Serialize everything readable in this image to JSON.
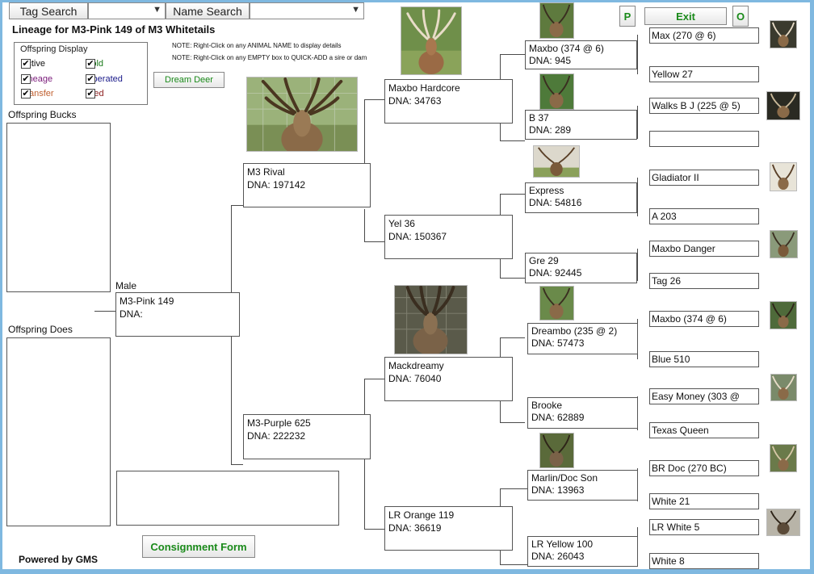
{
  "toolbar": {
    "tag_search_label": "Tag Search",
    "name_search_label": "Name Search",
    "p_label": "P",
    "exit_label": "Exit",
    "o_label": "O"
  },
  "page_title": "Lineage for M3-Pink 149 of M3 Whitetails",
  "notes": [
    "NOTE: Right-Click on any ANIMAL NAME to display details",
    "NOTE: Right-Click on any EMPTY box to QUICK-ADD a sire or dam"
  ],
  "offspring_display": {
    "title": "Offspring Display",
    "options": [
      {
        "label": "Active",
        "color": "#111111",
        "checked": true
      },
      {
        "label": "Sold",
        "color": "#1a7a1a",
        "checked": true
      },
      {
        "label": "Lineage",
        "color": "#7a1a7a",
        "checked": true
      },
      {
        "label": "Liberated",
        "color": "#1a1a8a",
        "checked": true
      },
      {
        "label": "Transfer",
        "color": "#c06030",
        "checked": true
      },
      {
        "label": "Died",
        "color": "#8a1a1a",
        "checked": true
      }
    ]
  },
  "dream_deer_label": "Dream Deer",
  "offspring_bucks_label": "Offspring Bucks",
  "offspring_does_label": "Offspring Does",
  "consignment_label": "Consignment Form",
  "powered_by": "Powered by GMS",
  "colors": {
    "accent_green": "#1a8a1a",
    "window_border": "#7fb8e0"
  },
  "subject": {
    "sex": "Male",
    "name": "M3-Pink 149",
    "dna": "DNA:"
  },
  "gen1": [
    {
      "name": "M3 Rival",
      "dna": "DNA:  197142"
    },
    {
      "name": "M3-Purple 625",
      "dna": "DNA:  222232"
    }
  ],
  "gen2": [
    {
      "name": "Maxbo Hardcore",
      "dna": "DNA: 34763"
    },
    {
      "name": "Yel 36",
      "dna": "DNA:  150367"
    },
    {
      "name": "Mackdreamy",
      "dna": "DNA:  76040"
    },
    {
      "name": "LR Orange 119",
      "dna": "DNA:  36619"
    }
  ],
  "gen3": [
    {
      "name": "Maxbo (374 @ 6)",
      "dna": "DNA: 945"
    },
    {
      "name": "B 37",
      "dna": "DNA:  289"
    },
    {
      "name": "Express",
      "dna": "DNA:  54816"
    },
    {
      "name": "Gre 29",
      "dna": "DNA:  92445"
    },
    {
      "name": "Dreambo (235 @ 2)",
      "dna": "DNA:  57473"
    },
    {
      "name": "Brooke",
      "dna": "DNA:  62889"
    },
    {
      "name": "Marlin/Doc Son",
      "dna": "DNA:  13963"
    },
    {
      "name": "LR Yellow 100",
      "dna": "DNA:  26043"
    }
  ],
  "gen4": [
    {
      "name": "Max (270 @ 6)"
    },
    {
      "name": "Yellow 27"
    },
    {
      "name": "Walks B J (225 @ 5)"
    },
    {
      "name": ""
    },
    {
      "name": "Gladiator II"
    },
    {
      "name": "A 203"
    },
    {
      "name": "Maxbo Danger"
    },
    {
      "name": "Tag 26"
    },
    {
      "name": "Maxbo (374 @ 6)"
    },
    {
      "name": "Blue 510"
    },
    {
      "name": "Easy Money (303 @"
    },
    {
      "name": "Texas Queen"
    },
    {
      "name": "BR Doc (270 BC)"
    },
    {
      "name": "White 21"
    },
    {
      "name": "LR White 5"
    },
    {
      "name": "White 8"
    }
  ]
}
